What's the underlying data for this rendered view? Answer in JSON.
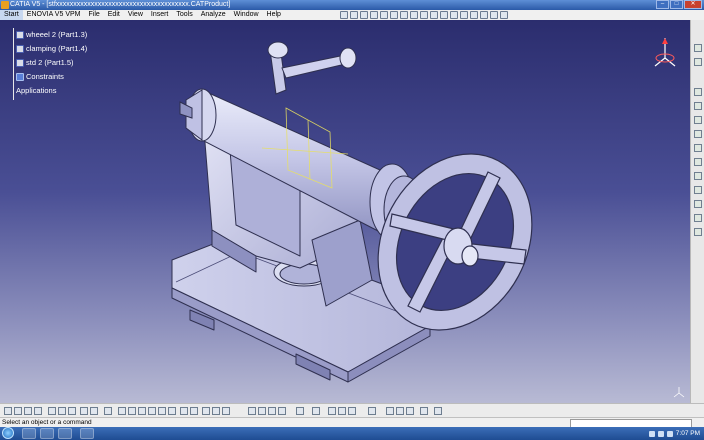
{
  "window": {
    "title": "CATIA V5 - [stfxxxxxxxxxxxxxxxxxxxxxxxxxxxxxxxxxxxxxx.CATProduct]"
  },
  "menu": [
    {
      "label": "Start"
    },
    {
      "label": "ENOVIA V5 VPM"
    },
    {
      "label": "File"
    },
    {
      "label": "Edit"
    },
    {
      "label": "View"
    },
    {
      "label": "Insert"
    },
    {
      "label": "Tools"
    },
    {
      "label": "Analyze"
    },
    {
      "label": "Window"
    },
    {
      "label": "Help"
    }
  ],
  "tree": {
    "items": [
      {
        "label": "wheeel 2 (Part1.3)",
        "icon": "part-icon"
      },
      {
        "label": "clamping (Part1.4)",
        "icon": "part-icon"
      },
      {
        "label": "std 2 (Part1.5)",
        "icon": "part-icon"
      },
      {
        "label": "Constraints",
        "icon": "constraints-icon"
      },
      {
        "label": "Applications",
        "icon": ""
      }
    ]
  },
  "status": {
    "message": "Select an object or a command"
  },
  "taskbar": {
    "time": "7:07 PM"
  },
  "colors": {
    "viewport_top": "#2b2d6e",
    "viewport_bottom": "#b8bad4",
    "model_fill": "#c9cbe8",
    "model_edge": "#3a3a5a"
  }
}
